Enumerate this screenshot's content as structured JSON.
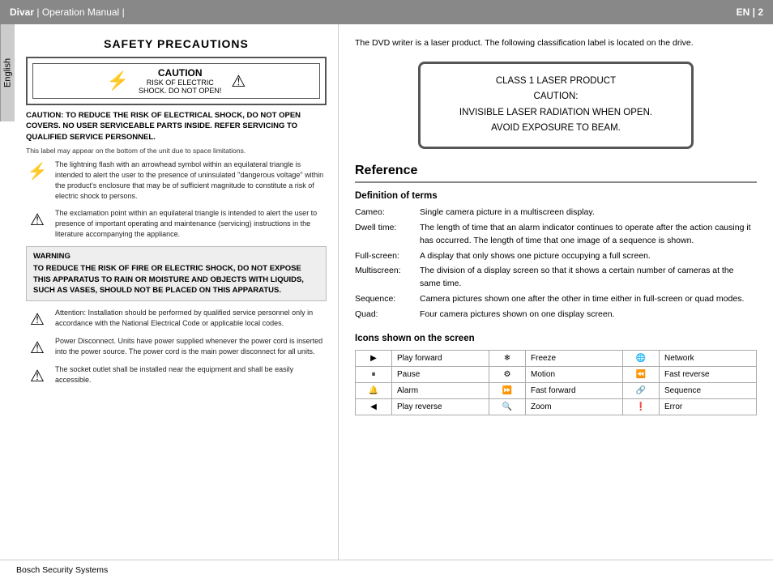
{
  "header": {
    "brand": "Divar",
    "separator": "|",
    "doc_type": "Operation Manual",
    "lang_code": "EN",
    "page_num": "2"
  },
  "lang_tab": "English",
  "footer": {
    "company": "Bosch Security Systems"
  },
  "left": {
    "safety_title": "SAFETY PRECAUTIONS",
    "caution_label": "CAUTION",
    "caution_sub1": "RISK OF ELECTRIC",
    "caution_sub2": "SHOCK. DO NOT OPEN!",
    "caution_warning": "CAUTION: TO REDUCE THE RISK OF ELECTRICAL SHOCK, DO NOT OPEN COVERS. NO USER SERVICEABLE PARTS INSIDE. REFER SERVICING TO QUALIFIED SERVICE PERSONNEL.",
    "label_note": "This label may appear on the bottom of the unit due to space limitations.",
    "lightning_text": "The lightning flash with an arrowhead symbol within an equilateral triangle is intended to alert the user to the presence of uninsulated \"dangerous voltage\" within the product's enclosure that may be of sufficient magnitude to constitute a risk of electric shock to persons.",
    "exclaim_text": "The exclamation point within an equilateral triangle is intended to alert the user to presence of important operating and maintenance (servicing) instructions in the literature accompanying the appliance.",
    "warning_title": "WARNING",
    "warning_text": "TO REDUCE THE RISK OF FIRE OR ELECTRIC SHOCK, DO NOT EXPOSE THIS APPARATUS TO RAIN OR MOISTURE AND OBJECTS WITH LIQUIDS, SUCH AS VASES, SHOULD NOT BE PLACED ON THIS APPARATUS.",
    "attention_text": "Attention:  Installation should be performed by qualified service personnel only in accordance with the National Electrical Code or applicable local codes.",
    "power_text": "Power Disconnect. Units have power supplied whenever the power cord is inserted into the power source. The power cord is the main power disconnect for all units.",
    "socket_text": "The socket outlet shall be installed near the equipment and shall be easily accessible."
  },
  "right": {
    "intro": "The DVD writer is a laser product. The following classification label is located on the drive.",
    "laser_box": {
      "line1": "CLASS 1 LASER PRODUCT",
      "line2": "CAUTION:",
      "line3": "INVISIBLE LASER RADIATION WHEN OPEN.",
      "line4": "AVOID EXPOSURE TO BEAM."
    },
    "reference_title": "Reference",
    "def_title": "Definition of terms",
    "definitions": [
      {
        "term": "Cameo:",
        "desc": "Single camera picture in a multiscreen display."
      },
      {
        "term": "Dwell time:",
        "desc": "The length of time that an alarm indicator continues to operate after the action causing it has occurred. The length of time that one image of a sequence is shown."
      },
      {
        "term": "Full-screen:",
        "desc": "A display that only shows one picture occupying a full screen."
      },
      {
        "term": "Multiscreen:",
        "desc": "The division of a display screen so that it shows a certain number of cameras at the same time."
      },
      {
        "term": "Sequence:",
        "desc": "Camera pictures shown one after the other in time either in full-screen or quad modes."
      },
      {
        "term": "Quad:",
        "desc": "Four camera pictures shown on one display screen."
      }
    ],
    "icons_title": "Icons shown on the screen",
    "icons": [
      {
        "symbol": "▶",
        "name": "Play forward"
      },
      {
        "symbol": "⏸",
        "name": "Pause"
      },
      {
        "symbol": "🔔",
        "name": "Alarm"
      },
      {
        "symbol": "◀",
        "name": "Play reverse"
      },
      {
        "symbol": "❄",
        "name": "Freeze"
      },
      {
        "symbol": "⚙",
        "name": "Motion"
      },
      {
        "symbol": "⏩",
        "name": "Fast forward"
      },
      {
        "symbol": "🔍",
        "name": "Zoom"
      },
      {
        "symbol": "🌐",
        "name": "Network"
      },
      {
        "symbol": "⏪",
        "name": "Fast reverse"
      },
      {
        "symbol": "🔗",
        "name": "Sequence"
      },
      {
        "symbol": "❗",
        "name": "Error"
      }
    ]
  }
}
